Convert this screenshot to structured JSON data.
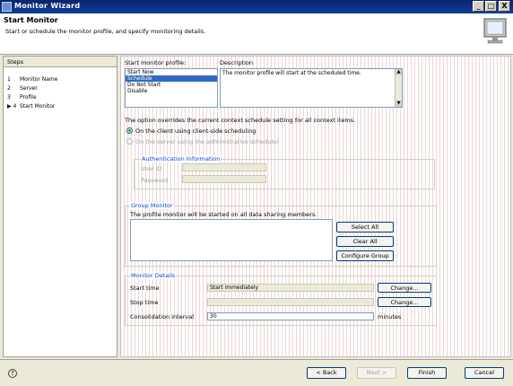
{
  "window": {
    "title": "Monitor Wizard",
    "controls": {
      "minimize": "_",
      "maximize": "□",
      "close": "X"
    }
  },
  "header": {
    "title": "Start Monitor",
    "description": "Start or schedule the monitor profile, and specify monitoring details."
  },
  "steps": {
    "heading": "Steps",
    "items": [
      {
        "marker": "1",
        "label": "Monitor Name"
      },
      {
        "marker": "2",
        "label": "Server"
      },
      {
        "marker": "3",
        "label": "Profile"
      },
      {
        "marker": "▶ 4",
        "label": "Start Monitor"
      }
    ]
  },
  "profile": {
    "label": "Start monitor profile:",
    "options": [
      "Start Now",
      "Schedule",
      "Do Not Start",
      "Disable"
    ],
    "selected_index": 1
  },
  "description": {
    "label": "Description",
    "text": "The monitor profile will start at the scheduled time."
  },
  "scheduling": {
    "note": "The option overrides the current context schedule setting for all context items.",
    "option_client": "On the client using client-side scheduling",
    "option_server": "On the server using the administrative scheduler"
  },
  "auth": {
    "title": "Authentication Information",
    "user_label": "User ID",
    "user_value": "",
    "password_label": "Password",
    "password_value": ""
  },
  "group_monitor": {
    "title": "Group Monitor",
    "description": "The profile monitor will be started on all data sharing members.",
    "select_all": "Select All",
    "deselect_all": "Clear All",
    "configure": "Configure Group"
  },
  "details": {
    "title": "Monitor Details",
    "start_label": "Start time",
    "start_value": "Start immediately",
    "stop_label": "Stop time",
    "stop_value": "",
    "change1": "Change...",
    "change2": "Change...",
    "interval_label": "Consolidation interval",
    "interval_value": "30",
    "interval_unit": "minutes"
  },
  "footer": {
    "help": "?",
    "back": "< Back",
    "next": "Next >",
    "finish": "Finish",
    "cancel": "Cancel"
  }
}
